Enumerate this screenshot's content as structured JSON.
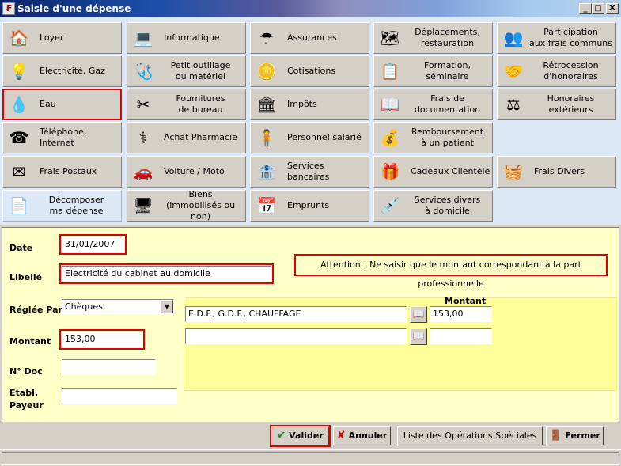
{
  "window": {
    "title": "Saisie d'une dépense",
    "controls": [
      "_",
      "□",
      "X"
    ]
  },
  "categories": [
    {
      "label": "Loyer",
      "icon": "house-icon",
      "glyph": "🏠"
    },
    {
      "label": "Informatique",
      "icon": "computer-icon",
      "glyph": "💻"
    },
    {
      "label": "Assurances",
      "icon": "umbrella-icon",
      "glyph": "☂"
    },
    {
      "label": "Déplacements,\nrestauration",
      "icon": "france-map-icon",
      "glyph": "🗺"
    },
    {
      "label": "Participation\naux frais communs",
      "icon": "people-icon",
      "glyph": "👥"
    },
    {
      "label": "Electricité, Gaz",
      "icon": "lightbulb-icon",
      "glyph": "💡"
    },
    {
      "label": "Petit outillage\nou matériel",
      "icon": "stethoscope-icon",
      "glyph": "🩺"
    },
    {
      "label": "Cotisations",
      "icon": "coin-icon",
      "glyph": "🪙"
    },
    {
      "label": "Formation,\nséminaire",
      "icon": "whiteboard-icon",
      "glyph": "📋"
    },
    {
      "label": "Rétrocession\nd'honoraires",
      "icon": "handshake-icon",
      "glyph": "🤝"
    },
    {
      "label": "Eau",
      "icon": "water-drop-icon",
      "glyph": "💧"
    },
    {
      "label": "Fournitures\nde bureau",
      "icon": "scissors-icon",
      "glyph": "✂"
    },
    {
      "label": "Impôts",
      "icon": "tresor-public-icon",
      "glyph": "🏛"
    },
    {
      "label": "Frais de\ndocumentation",
      "icon": "book-icon",
      "glyph": "📖"
    },
    {
      "label": "Honoraires\nextérieurs",
      "icon": "lawyer-icon",
      "glyph": "⚖"
    },
    {
      "label": "Téléphone, Internet",
      "icon": "telephone-icon",
      "glyph": "☎"
    },
    {
      "label": "Achat Pharmacie",
      "icon": "caduceus-icon",
      "glyph": "⚕"
    },
    {
      "label": "Personnel salarié",
      "icon": "person-icon",
      "glyph": "🧍"
    },
    {
      "label": "Remboursement\nà un patient",
      "icon": "money-bag-icon",
      "glyph": "💰"
    },
    {
      "label": "Frais Postaux",
      "icon": "envelope-icon",
      "glyph": "✉"
    },
    {
      "label": "Voiture / Moto",
      "icon": "car-icon",
      "glyph": "🚗"
    },
    {
      "label": "Services bancaires",
      "icon": "bank-icon",
      "glyph": "🏦"
    },
    {
      "label": "Cadeaux Clientèle",
      "icon": "gift-icon",
      "glyph": "🎁"
    },
    {
      "label": "Frais Divers",
      "icon": "basket-icon",
      "glyph": "🧺"
    },
    {
      "label": "Décomposer\nma dépense",
      "icon": "document-split-icon",
      "glyph": "📄"
    },
    {
      "label": "Biens\n(immobilisés ou non)",
      "icon": "computer-assets-icon",
      "glyph": "🖥"
    },
    {
      "label": "Emprunts",
      "icon": "calendar-icon",
      "glyph": "📅"
    },
    {
      "label": "Services divers\nà domicile",
      "icon": "syringe-icon",
      "glyph": "💉"
    }
  ],
  "form": {
    "date_label": "Date",
    "date_value": "31/01/2007",
    "libelle_label": "Libellé",
    "libelle_value": "Electricité du cabinet au domicile",
    "notice": "Attention ! Ne saisir que le montant correspondant à la part professionnelle",
    "reglee_label": "Réglée Par",
    "reglee_value": "Chèques",
    "montant_label": "Montant",
    "montant_value": "153,00",
    "ndoc_label": "N° Doc",
    "ndoc_value": "",
    "etabl_label_1": "Etabl.",
    "etabl_label_2": "Payeur",
    "etabl_value": ""
  },
  "breakdown": {
    "montant_header": "Montant",
    "rows": [
      {
        "description": "E.D.F., G.D.F., CHAUFFAGE",
        "amount": "153,00"
      },
      {
        "description": "",
        "amount": ""
      }
    ]
  },
  "buttons": {
    "valider": "Valider",
    "annuler": "Annuler",
    "liste": "Liste des Opérations Spéciales",
    "fermer": "Fermer"
  },
  "colors": {
    "accent_red": "#e00000",
    "form_bg": "#ffffc8",
    "panel_bg": "#ffff99",
    "grid_bg": "#dde8f6"
  }
}
